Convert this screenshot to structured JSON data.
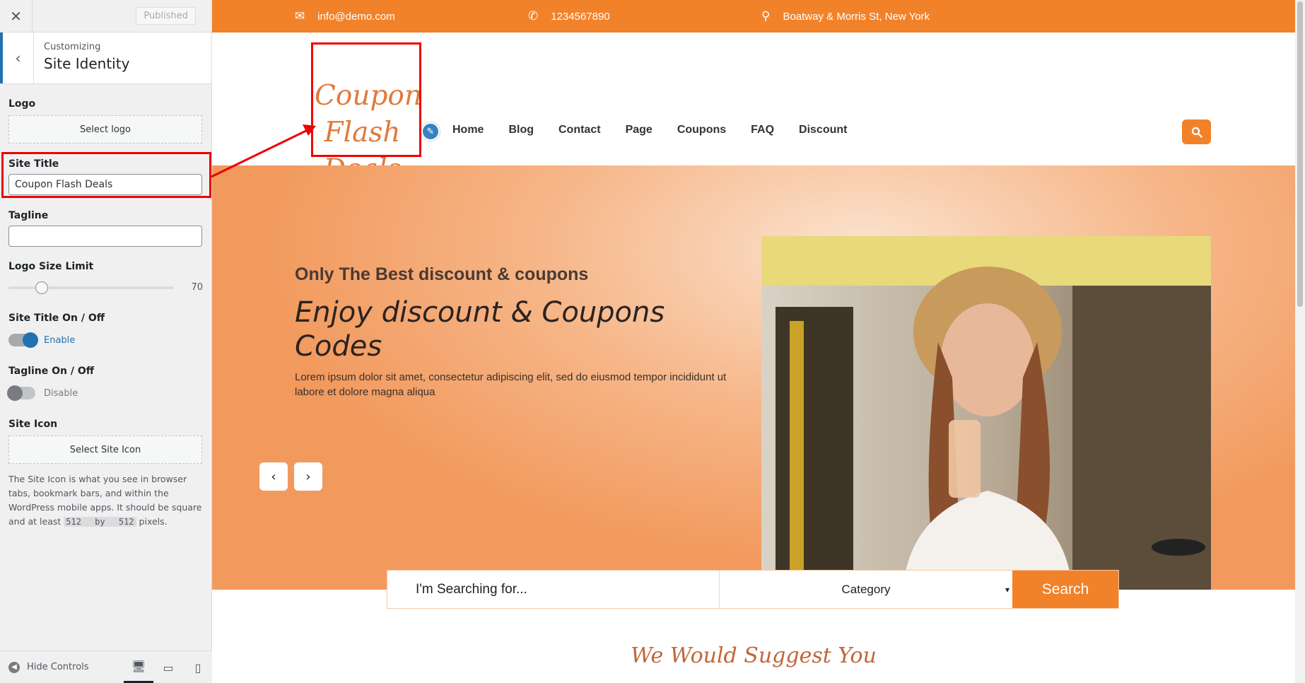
{
  "customizer": {
    "published_label": "Published",
    "breadcrumb": "Customizing",
    "section_title": "Site Identity",
    "logo_label": "Logo",
    "select_logo": "Select logo",
    "site_title_label": "Site Title",
    "site_title_value": "Coupon Flash Deals",
    "tagline_label": "Tagline",
    "tagline_value": "",
    "logo_size_label": "Logo Size Limit",
    "logo_size_value": "70",
    "logo_size_fraction": 0.2,
    "site_title_toggle_label": "Site Title On / Off",
    "site_title_toggle_state": "Enable",
    "tagline_toggle_label": "Tagline On / Off",
    "tagline_toggle_state": "Disable",
    "site_icon_label": "Site Icon",
    "select_site_icon": "Select Site Icon",
    "site_icon_desc": "The Site Icon is what you see in browser tabs, bookmark bars, and within the WordPress mobile apps. It should be square and at least",
    "site_icon_size_w": "512",
    "site_icon_size_by": "by",
    "site_icon_size_h": "512",
    "site_icon_size_unit": "pixels.",
    "hide_controls": "Hide Controls"
  },
  "topbar": {
    "email": "info@demo.com",
    "phone": "1234567890",
    "address": "Boatway & Morris St, New York"
  },
  "site": {
    "logo_line1": "Coupon",
    "logo_line2": "Flash",
    "logo_line3": "Deals",
    "menu": [
      "Home",
      "Blog",
      "Contact",
      "Page",
      "Coupons",
      "FAQ",
      "Discount"
    ]
  },
  "hero": {
    "subtitle": "Only The Best discount & coupons",
    "title": "Enjoy discount & Coupons Codes",
    "description": "Lorem ipsum dolor sit amet, consectetur adipiscing elit, sed do eiusmod tempor incididunt ut labore et dolore magna aliqua"
  },
  "search": {
    "placeholder": "I'm Searching for...",
    "category": "Category",
    "button": "Search"
  },
  "suggest_title": "We Would Suggest You",
  "colors": {
    "accent": "#f2822a",
    "wp_blue": "#2271b1",
    "annotation_red": "#ee0000"
  }
}
